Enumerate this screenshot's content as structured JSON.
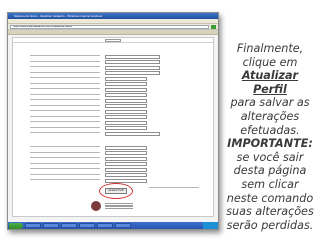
{
  "window": {
    "title": "Sistema do Aluno - Atualizar Cadastro - Windows Internet Explorer",
    "address": "https://www.sistemadoaluno.com.br/atualizar-dados"
  },
  "form": {
    "save_button_label": "Atualizar Perfil"
  },
  "caption": {
    "line1": "Finalmente,",
    "line2": "clique em",
    "highlight": "Atualizar Perfil",
    "line3": "para salvar as",
    "line4": "alterações",
    "line5": "efetuadas.",
    "important": "IMPORTANTE:",
    "line6": "se você sair",
    "line7": "desta página",
    "line8": "sem clicar",
    "line9": "neste comando",
    "line10": "suas alterações",
    "line11": "serão perdidas."
  },
  "colors": {
    "highlight_circle": "#d03030",
    "caption_text": "#3a3a3a"
  }
}
